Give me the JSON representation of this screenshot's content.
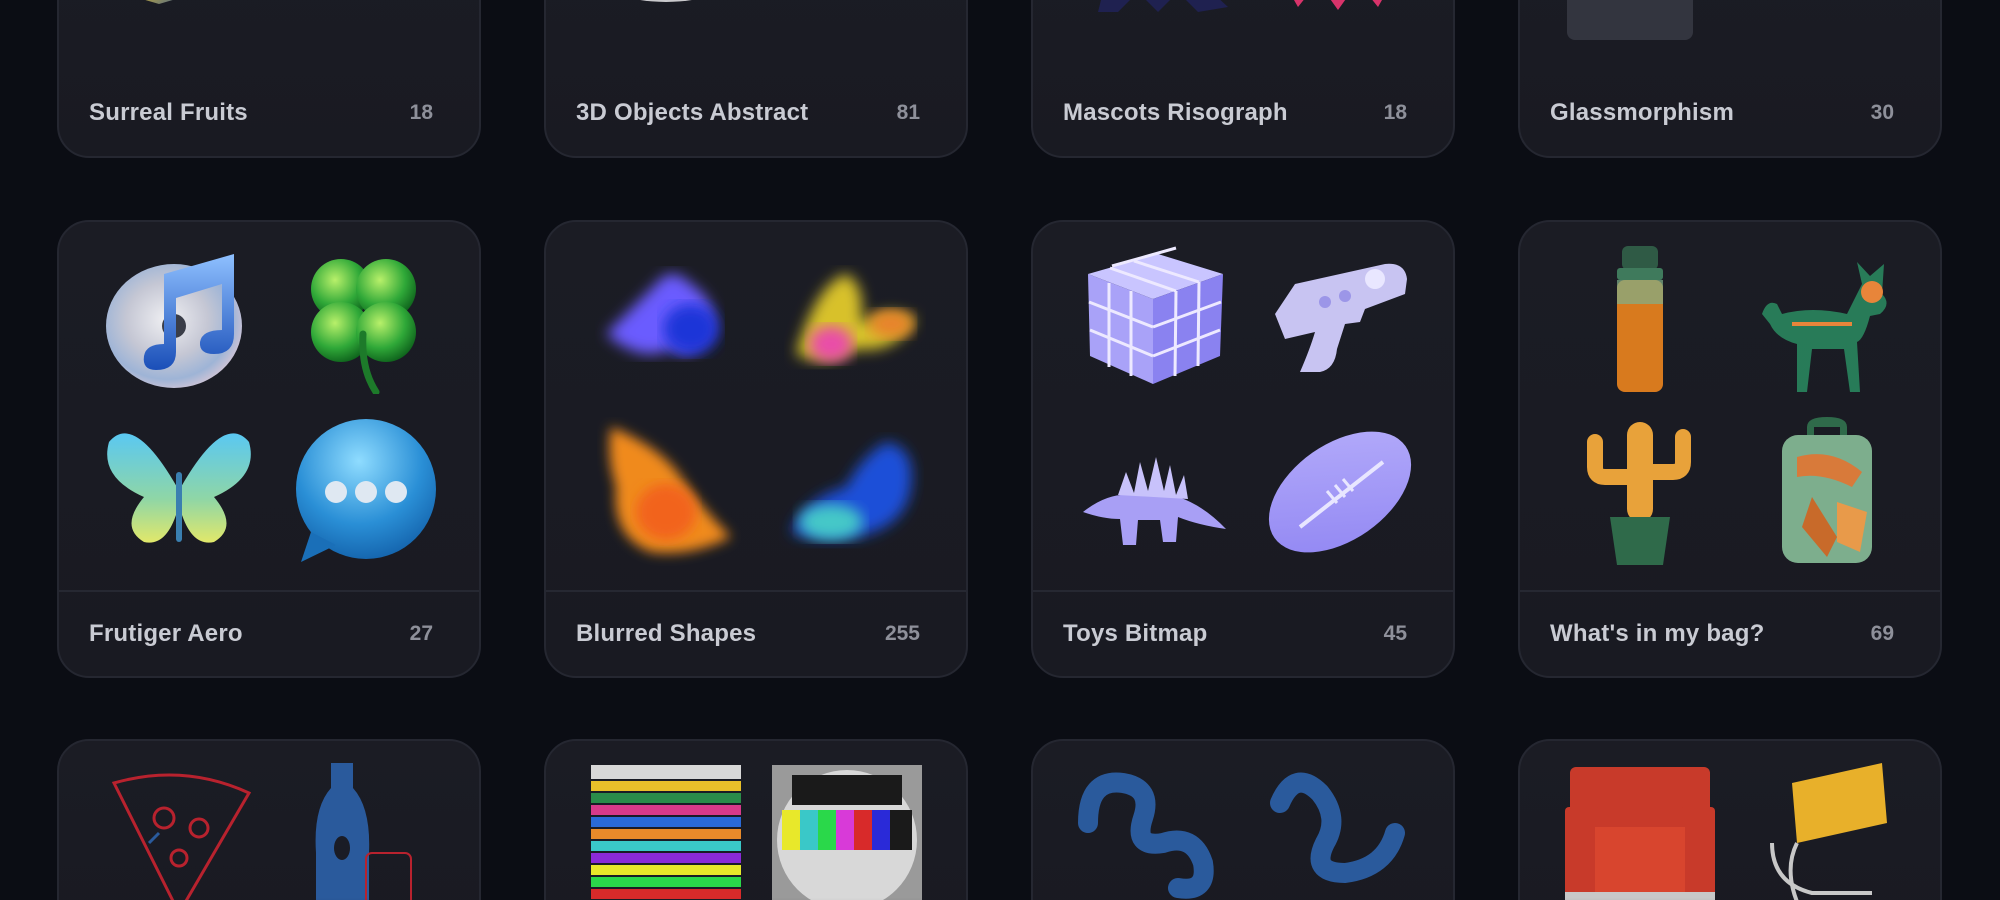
{
  "collections": [
    {
      "title": "Surreal Fruits",
      "count": "18"
    },
    {
      "title": "3D Objects Abstract",
      "count": "81"
    },
    {
      "title": "Mascots Risograph",
      "count": "18"
    },
    {
      "title": "Glassmorphism",
      "count": "30"
    },
    {
      "title": "Frutiger Aero",
      "count": "27"
    },
    {
      "title": "Blurred Shapes",
      "count": "255"
    },
    {
      "title": "Toys Bitmap",
      "count": "45"
    },
    {
      "title": "What's in my bag?",
      "count": "69"
    }
  ],
  "thumb_icons": {
    "frutiger_aero": [
      "music-note-disc-icon",
      "four-leaf-clover-icon",
      "butterfly-icon",
      "chat-bubble-icon"
    ],
    "blurred_shapes": [
      "blur-blue-purple-icon",
      "blur-yellow-pink-icon",
      "blur-orange-icon",
      "blur-cyan-blue-icon"
    ],
    "toys_bitmap": [
      "rubiks-cube-icon",
      "toy-gun-icon",
      "stegosaurus-icon",
      "football-icon"
    ],
    "whats_in_my_bag": [
      "water-bottle-icon",
      "xray-dog-icon",
      "cactus-icon",
      "backpack-icon"
    ],
    "row3_col1": [
      "pizza-slice-icon",
      "bottle-vase-icon"
    ],
    "row3_col2": [
      "glitch-broadcast-icon",
      "test-pattern-tv-icon"
    ],
    "row3_col3": [
      "blue-squiggle-icon",
      "blue-wave-icon"
    ],
    "row3_col4": [
      "red-armchair-icon",
      "yellow-chair-icon"
    ]
  },
  "colors": {
    "background": "#0b0d14",
    "card": "#1b1c24",
    "card_border": "#252731",
    "title_text": "#c9cbd3",
    "count_text": "#8e909a",
    "blur_accent": "#6b5cff"
  }
}
